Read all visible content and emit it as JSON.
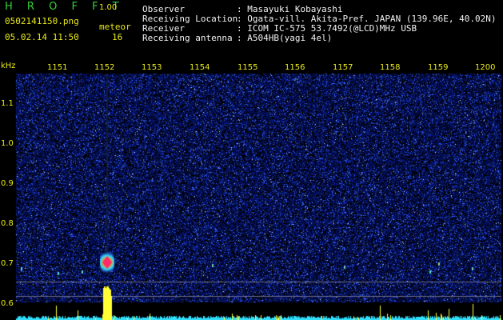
{
  "app": {
    "title": "H R O F F T",
    "version": "1.00",
    "filename": "0502141150.png",
    "datetime": "05.02.14 11:50",
    "meteor_label": "meteor",
    "meteor_count": "16"
  },
  "station": [
    {
      "label": "Observer",
      "value": ": Masayuki Kobayashi"
    },
    {
      "label": "Receiving Location",
      "value": ": Ogata-vill. Akita-Pref. JAPAN (139.96E, 40.02N)"
    },
    {
      "label": "Receiver",
      "value": ": ICOM IC-575 53.7492(@LCD)MHz USB"
    },
    {
      "label": "Receiving antenna",
      "value": ": A504HB(yagi 4el)"
    }
  ],
  "axis": {
    "unit": "kHz",
    "time_ticks": [
      "1151",
      "1152",
      "1153",
      "1154",
      "1155",
      "1156",
      "1157",
      "1158",
      "1159",
      "1200"
    ],
    "freq_ticks": [
      "1.1",
      "1.0",
      "0.9",
      "0.8",
      "0.7",
      "0.6"
    ]
  },
  "colors": {
    "background": "#000000",
    "noise_low": "#0b1a9a",
    "noise_high": "#3a6cff",
    "meteor_core": "#ff2a6a",
    "meteor_glow": "#30e0ff",
    "level_bar": "#ffff33",
    "baseline": "#30e0ff",
    "label_yellow": "#e8e81a",
    "title_green": "#34d13a"
  }
}
